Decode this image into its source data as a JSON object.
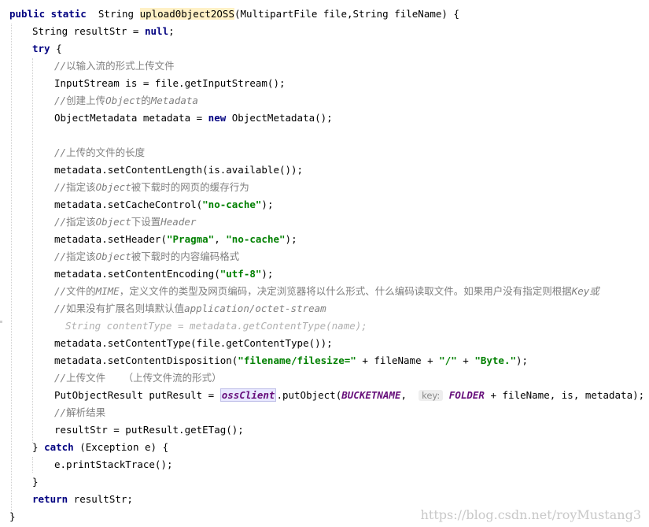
{
  "lines": {
    "l1": {
      "kw1": "public static",
      "pre": "  String ",
      "method": "upload0bject2OSS",
      "post": "(MultipartFile file,String fileName) {"
    },
    "l2": {
      "pre": "String resultStr = ",
      "kw": "null",
      "post": ";"
    },
    "l3": {
      "kw": "try",
      "post": " {"
    },
    "l4": {
      "slashes": "//",
      "cjk": "以输入流的形式上传文件"
    },
    "l5": {
      "text": "InputStream is = file.getInputStream();"
    },
    "l6": {
      "slashes": "//",
      "cjk1": "创建上传",
      "obj": "Object",
      "cjk2": "的",
      "tail": "Metadata"
    },
    "l7": {
      "pre": "ObjectMetadata metadata = ",
      "kw": "new",
      "post": " ObjectMetadata();"
    },
    "l8": {
      "slashes": "//",
      "cjk": "上传的文件的长度"
    },
    "l9": {
      "text": "metadata.setContentLength(is.available());"
    },
    "l10": {
      "slashes": "//",
      "cjk1": "指定该",
      "obj": "Object",
      "cjk2": "被下载时的网页的缓存行为"
    },
    "l11": {
      "pre": "metadata.setCacheControl(",
      "str": "\"no-cache\"",
      "post": ");"
    },
    "l12": {
      "slashes": "//",
      "cjk1": "指定该",
      "obj": "Object",
      "cjk2": "下设置",
      "tail": "Header"
    },
    "l13": {
      "pre": "metadata.setHeader(",
      "str1": "\"Pragma\"",
      "mid": ", ",
      "str2": "\"no-cache\"",
      "post": ");"
    },
    "l14": {
      "slashes": "//",
      "cjk1": "指定该",
      "obj": "Object",
      "cjk2": "被下载时的内容编码格式"
    },
    "l15": {
      "pre": "metadata.setContentEncoding(",
      "str": "\"utf-8\"",
      "post": ");"
    },
    "l16": {
      "slashes": "//",
      "cjk1": "文件的",
      "mime": "MIME",
      "cjk2": "，定义文件的类型及网页编码，决定浏览器将以什么形式、什么编码读取文件。如果用户没有指定则根据",
      "tail": "Key或"
    },
    "l17": {
      "slashes": "//",
      "cjk": "如果没有扩展名则填默认值",
      "tail": "application/octet-stream"
    },
    "l18": {
      "text": "String contentType = metadata.getContentType(name);"
    },
    "l19": {
      "text": "metadata.setContentType(file.getContentType());"
    },
    "l20": {
      "pre": "metadata.setContentDisposition(",
      "str1": "\"filename/filesize=\"",
      "mid1": " + fileName + ",
      "str2": "\"/\"",
      "mid2": " + ",
      "str3": "\"Byte.\"",
      "post": ");"
    },
    "l21": {
      "slashes": "//",
      "cjk": "上传文件   （上传文件流的形式）"
    },
    "l22": {
      "pre": "PutObjectResult putResult = ",
      "field": "ossClient",
      "mid": ".putObject(",
      "const1": "BUCKETNAME",
      "comma": ",  ",
      "hint": "key:",
      "space": " ",
      "const2": "FOLDER",
      "post": " + fileName, is, metadata);"
    },
    "l23": {
      "slashes": "//",
      "cjk": "解析结果"
    },
    "l24": {
      "text": "resultStr = putResult.getETag();"
    },
    "l25": {
      "pre": "} ",
      "kw": "catch",
      "post": " (Exception e) {"
    },
    "l26": {
      "text": "e.printStackTrace();"
    },
    "l27": {
      "text": "}"
    },
    "l28": {
      "kw": "return",
      "post": " resultStr;"
    },
    "l29": {
      "text": "}"
    }
  },
  "watermark": "https://blog.csdn.net/royMustang3"
}
